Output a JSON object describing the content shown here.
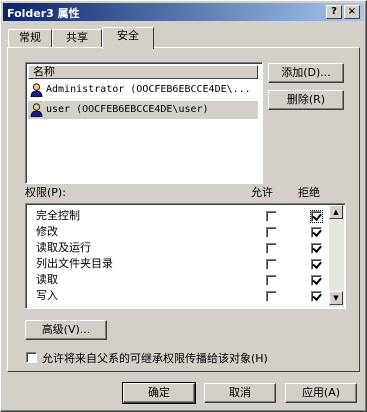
{
  "window": {
    "title": "Folder3 属性",
    "help_glyph": "?",
    "close_glyph": "×"
  },
  "tabs": [
    {
      "label": "常规"
    },
    {
      "label": "共享"
    },
    {
      "label": "安全",
      "active": true
    }
  ],
  "users_list": {
    "column_header": "名称",
    "items": [
      {
        "name": "Administrator (OOCFEB6EBCCE4DE\\...",
        "icon": "user-icon"
      },
      {
        "name": "user (OOCFEB6EBCCE4DE\\user)",
        "icon": "user-icon",
        "selected": true
      }
    ]
  },
  "buttons": {
    "add": "添加(D)...",
    "remove": "删除(R)",
    "advanced": "高级(V)...",
    "ok": "确定",
    "cancel": "取消",
    "apply": "应用(A)"
  },
  "permissions": {
    "label": "权限(P):",
    "allow_header": "允许",
    "deny_header": "拒绝",
    "rows": [
      {
        "name": "完全控制",
        "allow": false,
        "deny": true
      },
      {
        "name": "修改",
        "allow": false,
        "deny": true
      },
      {
        "name": "读取及运行",
        "allow": false,
        "deny": true
      },
      {
        "name": "列出文件夹目录",
        "allow": false,
        "deny": true
      },
      {
        "name": "读取",
        "allow": false,
        "deny": true
      },
      {
        "name": "写入",
        "allow": false,
        "deny": true
      }
    ]
  },
  "inherit_checkbox": {
    "label": "允许将来自父系的可继承权限传播给该对象(H)",
    "checked": false
  },
  "colors": {
    "face": "#d4d0c8",
    "title_start": "#0a246a",
    "title_end": "#a6caf0"
  }
}
